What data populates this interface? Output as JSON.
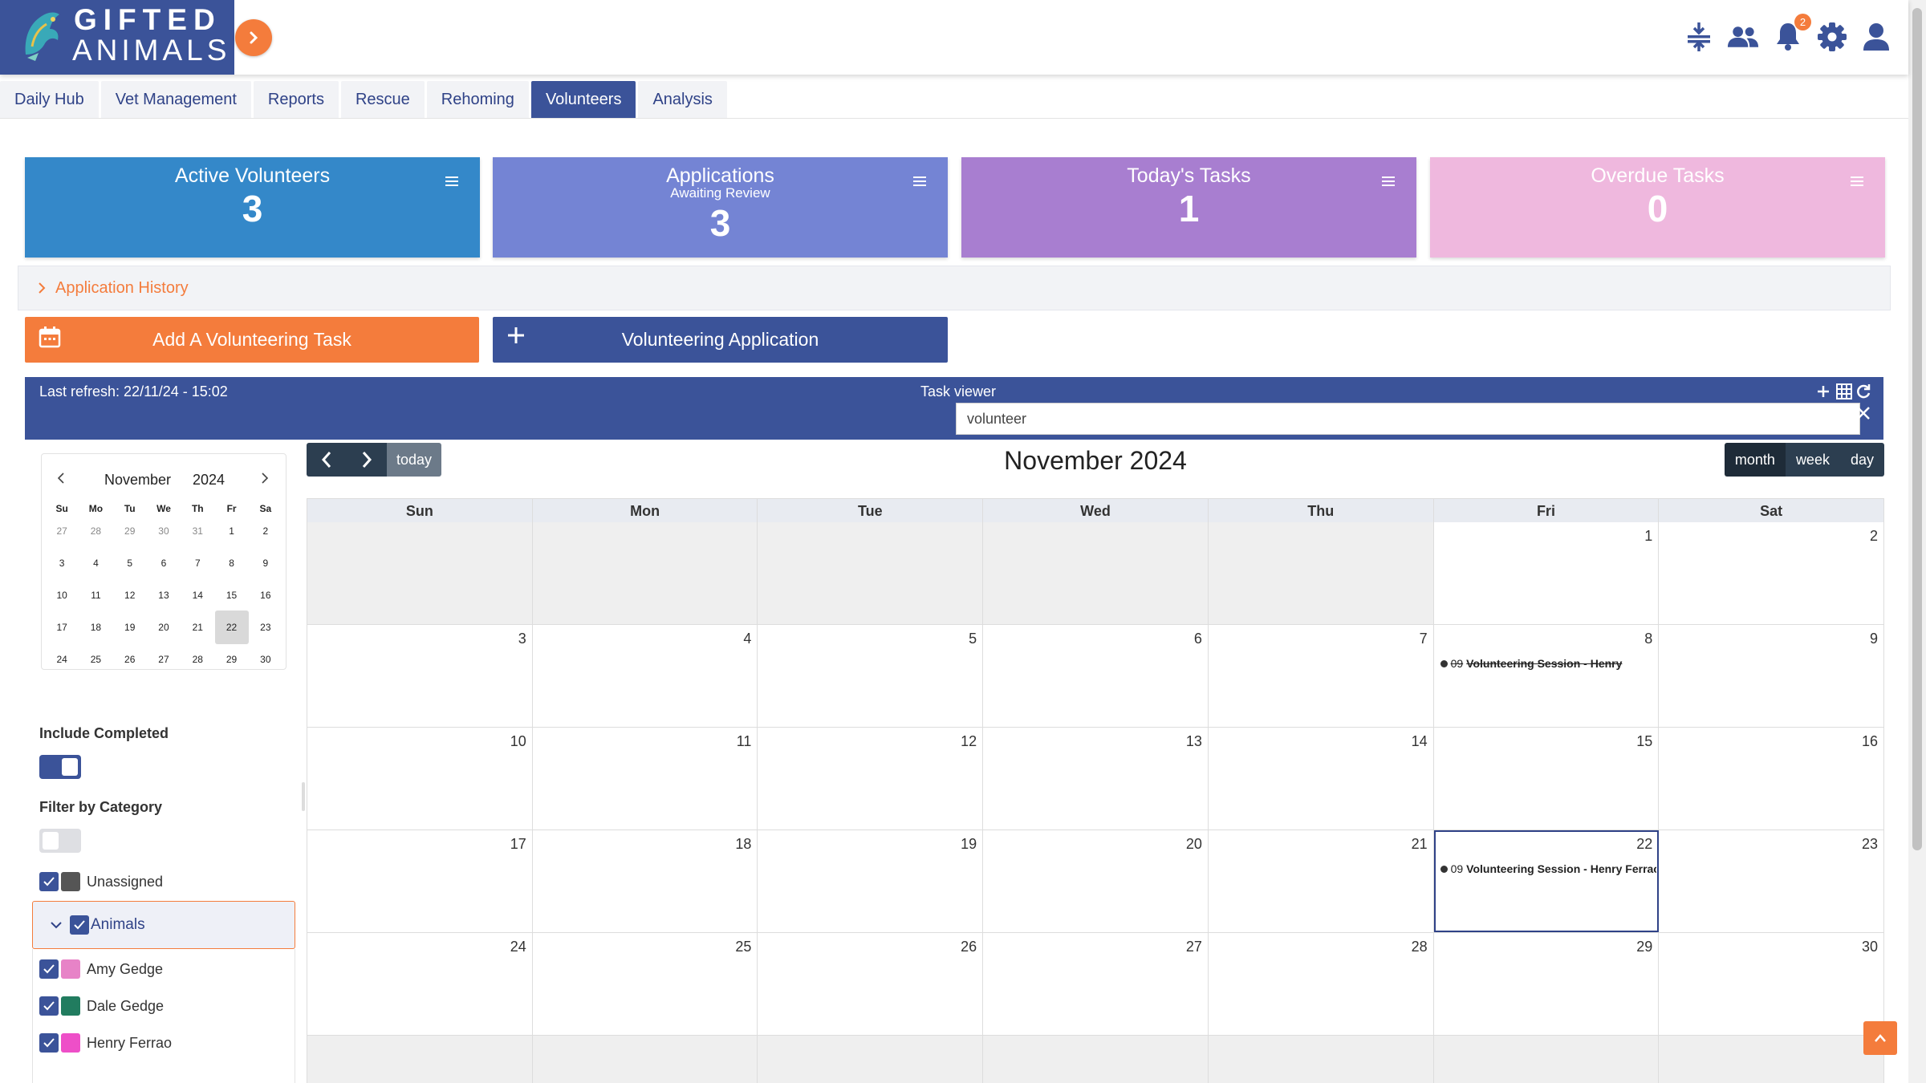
{
  "app": {
    "brand_line1": "GIFTED",
    "brand_line2": "ANIMALS",
    "notification_count": "2",
    "accent_color": "#f47c3c",
    "primary_color": "#3b5399"
  },
  "header_icons": [
    "compress-icon",
    "users-icon",
    "bell-icon",
    "gear-icon",
    "user-icon"
  ],
  "tabs": [
    {
      "label": "Daily Hub",
      "active": false
    },
    {
      "label": "Vet Management",
      "active": false
    },
    {
      "label": "Reports",
      "active": false
    },
    {
      "label": "Rescue",
      "active": false
    },
    {
      "label": "Rehoming",
      "active": false
    },
    {
      "label": "Volunteers",
      "active": true
    },
    {
      "label": "Analysis",
      "active": false
    }
  ],
  "cards": [
    {
      "title": "Active Volunteers",
      "subtitle": "",
      "value": "3",
      "color": "#3488c9"
    },
    {
      "title": "Applications",
      "subtitle": "Awaiting Review",
      "value": "3",
      "color": "#7484d4"
    },
    {
      "title": "Today's Tasks",
      "subtitle": "",
      "value": "1",
      "color": "#a87ed0"
    },
    {
      "title": "Overdue Tasks",
      "subtitle": "",
      "value": "0",
      "color": "#efb8de"
    }
  ],
  "history": {
    "label": "Application History"
  },
  "actions": {
    "add_task": "Add A Volunteering Task",
    "application": "Volunteering Application"
  },
  "viewer": {
    "last_refresh": "Last refresh: 22/11/24 - 15:02",
    "title": "Task viewer",
    "search_value": "volunteer"
  },
  "minical": {
    "month": "November",
    "year": "2024",
    "dow": [
      "Su",
      "Mo",
      "Tu",
      "We",
      "Th",
      "Fr",
      "Sa"
    ],
    "weeks": [
      [
        {
          "d": "27",
          "o": true
        },
        {
          "d": "28",
          "o": true
        },
        {
          "d": "29",
          "o": true
        },
        {
          "d": "30",
          "o": true
        },
        {
          "d": "31",
          "o": true
        },
        {
          "d": "1"
        },
        {
          "d": "2"
        }
      ],
      [
        {
          "d": "3"
        },
        {
          "d": "4"
        },
        {
          "d": "5"
        },
        {
          "d": "6"
        },
        {
          "d": "7"
        },
        {
          "d": "8"
        },
        {
          "d": "9"
        }
      ],
      [
        {
          "d": "10"
        },
        {
          "d": "11"
        },
        {
          "d": "12"
        },
        {
          "d": "13"
        },
        {
          "d": "14"
        },
        {
          "d": "15"
        },
        {
          "d": "16"
        }
      ],
      [
        {
          "d": "17"
        },
        {
          "d": "18"
        },
        {
          "d": "19"
        },
        {
          "d": "20"
        },
        {
          "d": "21"
        },
        {
          "d": "22",
          "sel": true
        },
        {
          "d": "23"
        }
      ],
      [
        {
          "d": "24"
        },
        {
          "d": "25"
        },
        {
          "d": "26"
        },
        {
          "d": "27"
        },
        {
          "d": "28"
        },
        {
          "d": "29"
        },
        {
          "d": "30"
        }
      ]
    ]
  },
  "filters": {
    "include_completed_label": "Include Completed",
    "include_completed": true,
    "category_label": "Filter by Category",
    "category_enabled": false,
    "unassigned": {
      "label": "Unassigned",
      "color": "#555555"
    },
    "group": {
      "label": "Animals"
    },
    "people": [
      {
        "label": "Amy Gedge",
        "color": "#e783c7"
      },
      {
        "label": "Dale Gedge",
        "color": "#217c5f"
      },
      {
        "label": "Henry Ferrao",
        "color": "#ee4fc8"
      }
    ]
  },
  "calendar": {
    "title": "November 2024",
    "today_label": "today",
    "views": [
      {
        "label": "month",
        "active": true
      },
      {
        "label": "week",
        "active": false
      },
      {
        "label": "day",
        "active": false
      }
    ],
    "dow": [
      "Sun",
      "Mon",
      "Tue",
      "Wed",
      "Thu",
      "Fri",
      "Sat"
    ],
    "weeks": [
      [
        {
          "d": "",
          "o": true
        },
        {
          "d": "",
          "o": true
        },
        {
          "d": "",
          "o": true
        },
        {
          "d": "",
          "o": true
        },
        {
          "d": "",
          "o": true
        },
        {
          "d": "1"
        },
        {
          "d": "2"
        }
      ],
      [
        {
          "d": "3"
        },
        {
          "d": "4"
        },
        {
          "d": "5"
        },
        {
          "d": "6"
        },
        {
          "d": "7"
        },
        {
          "d": "8",
          "event": {
            "time": "09",
            "title": "Volunteering Session - Henry",
            "done": true
          }
        },
        {
          "d": "9"
        }
      ],
      [
        {
          "d": "10"
        },
        {
          "d": "11"
        },
        {
          "d": "12"
        },
        {
          "d": "13"
        },
        {
          "d": "14"
        },
        {
          "d": "15"
        },
        {
          "d": "16"
        }
      ],
      [
        {
          "d": "17"
        },
        {
          "d": "18"
        },
        {
          "d": "19"
        },
        {
          "d": "20"
        },
        {
          "d": "21"
        },
        {
          "d": "22",
          "today": true,
          "event": {
            "time": "09",
            "title": "Volunteering Session - Henry Ferrao",
            "done": false
          }
        },
        {
          "d": "23"
        }
      ],
      [
        {
          "d": "24"
        },
        {
          "d": "25"
        },
        {
          "d": "26"
        },
        {
          "d": "27"
        },
        {
          "d": "28"
        },
        {
          "d": "29"
        },
        {
          "d": "30"
        }
      ]
    ]
  }
}
